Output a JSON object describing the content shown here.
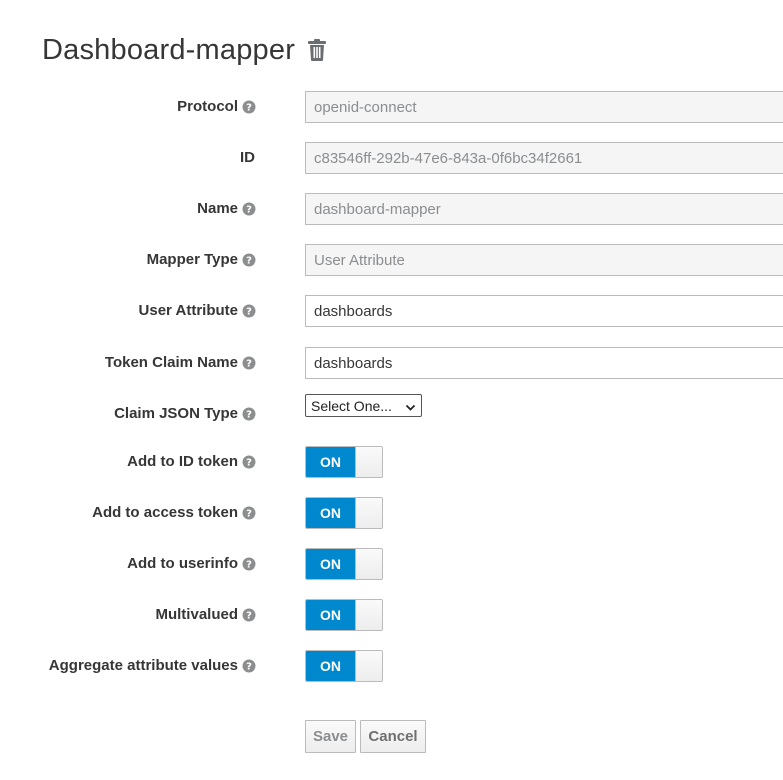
{
  "header": {
    "title": "Dashboard-mapper",
    "delete_icon": "trash-icon"
  },
  "fields": {
    "protocol": {
      "label": "Protocol",
      "value": "openid-connect",
      "readonly": true
    },
    "id": {
      "label": "ID",
      "value": "c83546ff-292b-47e6-843a-0f6bc34f2661",
      "readonly": true
    },
    "name": {
      "label": "Name",
      "value": "dashboard-mapper",
      "readonly": true
    },
    "mapper_type": {
      "label": "Mapper Type",
      "value": "User Attribute",
      "readonly": true
    },
    "user_attribute": {
      "label": "User Attribute",
      "value": "dashboards"
    },
    "token_claim_name": {
      "label": "Token Claim Name",
      "value": "dashboards"
    },
    "claim_json_type": {
      "label": "Claim JSON Type",
      "value": "Select One..."
    }
  },
  "toggles": {
    "add_to_id_token": {
      "label": "Add to ID token",
      "state": "ON"
    },
    "add_to_access_token": {
      "label": "Add to access token",
      "state": "ON"
    },
    "add_to_userinfo": {
      "label": "Add to userinfo",
      "state": "ON"
    },
    "multivalued": {
      "label": "Multivalued",
      "state": "ON"
    },
    "aggregate_attribute_values": {
      "label": "Aggregate attribute values",
      "state": "ON"
    }
  },
  "actions": {
    "save_label": "Save",
    "cancel_label": "Cancel"
  },
  "colors": {
    "toggle_on": "#0088ce",
    "readonly_bg": "#f5f5f5",
    "text": "#363636"
  }
}
